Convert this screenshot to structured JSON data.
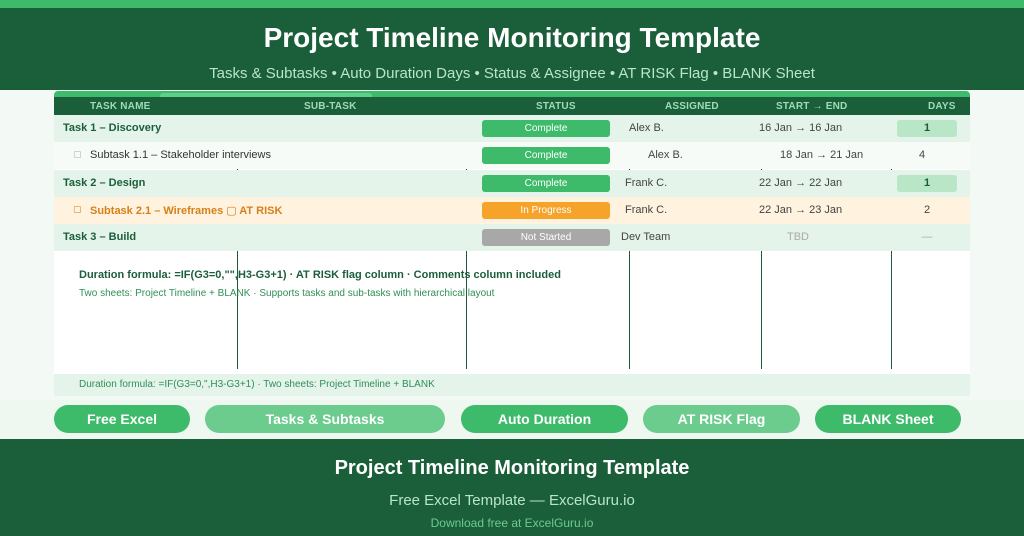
{
  "header": {
    "title": "Project Timeline Monitoring Template",
    "subtitle": "Tasks & Subtasks • Auto Duration Days • Status & Assignee • AT RISK Flag • BLANK Sheet"
  },
  "columns": {
    "task_name": "TASK NAME",
    "sub_task": "SUB-TASK",
    "status": "STATUS",
    "assigned": "ASSIGNED",
    "start_end": "START → END",
    "days": "DAYS"
  },
  "rows": [
    {
      "name": "Task 1 – Discovery",
      "status": "Complete",
      "assignee": "Alex B.",
      "dates": "16 Jan → 16 Jan",
      "days": "1"
    },
    {
      "bullet": "▢",
      "name": "Subtask 1.1 – Stakeholder interviews",
      "status": "Complete",
      "assignee": "Alex B.",
      "dates": "18 Jan → 21 Jan",
      "days": "4"
    },
    {
      "name": "Task 2 – Design",
      "status": "Complete",
      "assignee": "Frank C.",
      "dates": "22 Jan → 22 Jan",
      "days": "1"
    },
    {
      "bullet": "▢",
      "name": "Subtask 2.1 – Wireframes ▢ AT RISK",
      "status": "In Progress",
      "assignee": "Frank C.",
      "dates": "22 Jan → 23 Jan",
      "days": "2"
    },
    {
      "name": "Task 3 – Build",
      "status": "Not Started",
      "assignee": "Dev Team",
      "dates": "TBD",
      "days": "—"
    }
  ],
  "notes": {
    "formula": "Duration formula: =IF(G3=0,\"\",H3-G3+1) · AT RISK flag column · Comments column included",
    "sheets": "Two sheets: Project Timeline + BLANK · Supports tasks and sub-tasks with hierarchical layout",
    "footer_note": "Duration formula: =IF(G3=0,\",H3-G3+1) · Two sheets: Project Timeline + BLANK"
  },
  "buttons": [
    "Free Excel",
    "Tasks & Subtasks",
    "Auto Duration",
    "AT RISK Flag",
    "BLANK Sheet"
  ],
  "footer": {
    "title": "Project Timeline Monitoring Template",
    "subtitle": "Free Excel Template — ExcelGuru.io",
    "download": "Download free at ExcelGuru.io"
  },
  "colors": {
    "dark_green": "#1b5e3a",
    "accent_green": "#3dbb6a",
    "light_green": "#6ccc8e",
    "in_progress": "#f5a329",
    "not_started": "#a8a8a8",
    "at_risk_text": "#d5801a"
  }
}
